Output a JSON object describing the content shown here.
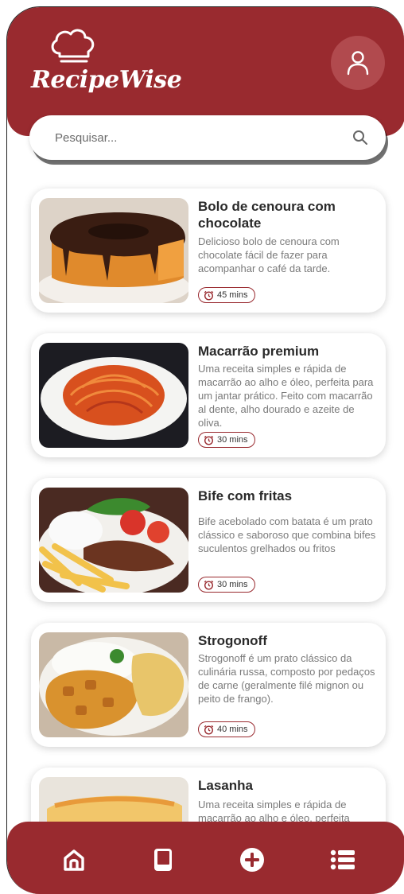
{
  "app": {
    "name": "RecipeWise"
  },
  "colors": {
    "primary": "#992a2f",
    "profile_bg": "#b14a4e",
    "text": "#2a2a2a",
    "muted": "#7a7a7a"
  },
  "search": {
    "placeholder": "Pesquisar..."
  },
  "recipes": [
    {
      "title": "Bolo de cenoura com chocolate",
      "description": "Delicioso bolo de cenoura com chocolate fácil de fazer para acompanhar o café da tarde.",
      "time": "45 mins",
      "image": "cake-photo"
    },
    {
      "title": "Macarrão premium",
      "description": "Uma receita simples e rápida de macarrão ao alho e óleo, perfeita para um jantar prático. Feito com macarrão al dente, alho dourado e azeite de oliva.",
      "time": "30 mins",
      "image": "spaghetti-photo"
    },
    {
      "title": "Bife com fritas",
      "description": "Bife acebolado com batata é um prato clássico e saboroso que combina bifes suculentos grelhados ou fritos",
      "time": "30 mins",
      "image": "steak-fries-photo"
    },
    {
      "title": "Strogonoff",
      "description": "Strogonoff é um prato clássico da culinária russa, composto por pedaços de carne (geralmente filé mignon ou peito de frango).",
      "time": "40 mins",
      "image": "strogonoff-photo"
    },
    {
      "title": "Lasanha",
      "description": "Uma receita simples e rápida de macarrão ao alho e óleo, perfeita",
      "time": "",
      "image": "lasagna-photo"
    }
  ],
  "nav": [
    {
      "icon": "home-icon"
    },
    {
      "icon": "book-icon"
    },
    {
      "icon": "add-circle-icon"
    },
    {
      "icon": "list-icon"
    }
  ]
}
